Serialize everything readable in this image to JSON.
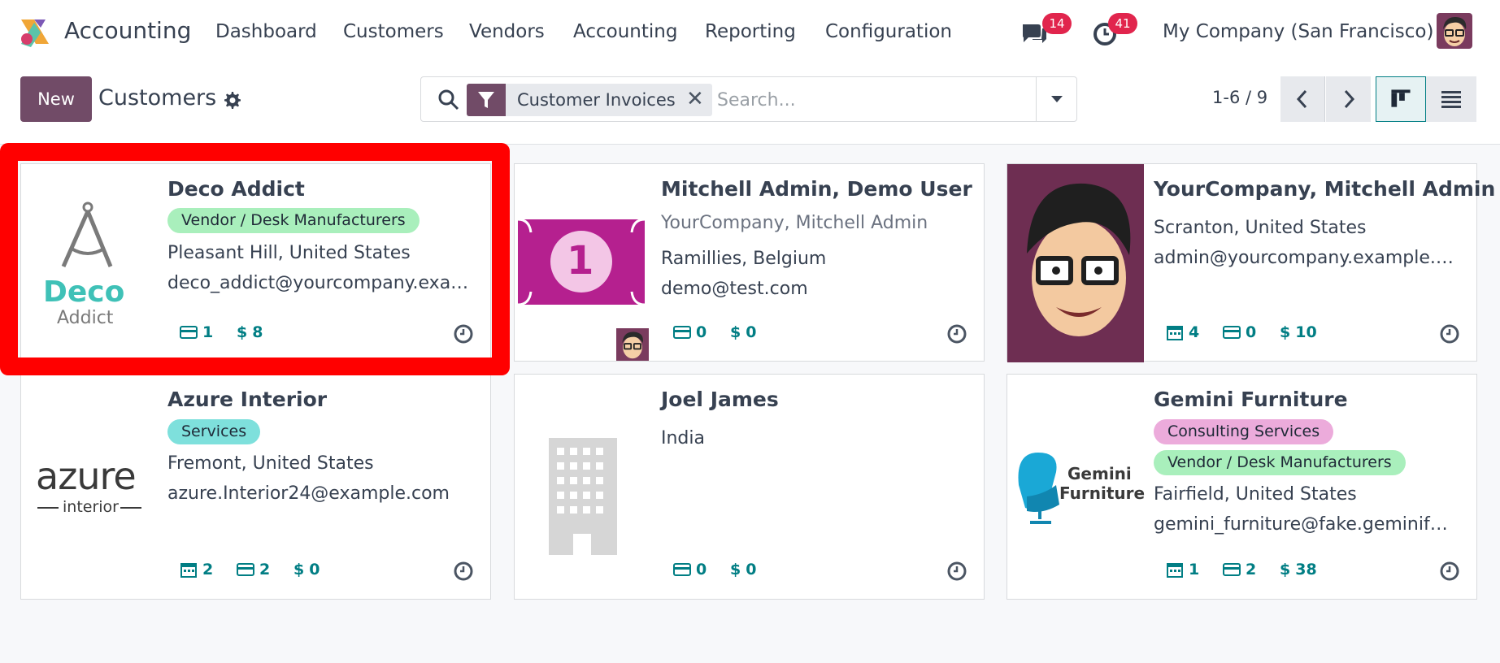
{
  "app": {
    "name": "Accounting",
    "nav": [
      "Dashboard",
      "Customers",
      "Vendors",
      "Accounting",
      "Reporting",
      "Configuration"
    ],
    "messages_badge": "14",
    "activities_badge": "41",
    "company": "My Company (San Francisco)"
  },
  "control": {
    "new_label": "New",
    "title": "Customers",
    "facet_label": "Customer Invoices",
    "search_placeholder": "Search...",
    "pager": "1-6 / 9"
  },
  "cards": [
    {
      "name": "Deco Addict",
      "tags": [
        {
          "label": "Vendor / Desk Manufacturers",
          "color": "#a9efbc"
        }
      ],
      "location": "Pleasant Hill, United States",
      "email": "deco_addict@yourcompany.exa…",
      "stats": {
        "invoices": "1",
        "amount": "8"
      },
      "logo_text": [
        "Deco",
        "Addict"
      ]
    },
    {
      "name": "Mitchell Admin, Demo User",
      "subtitle": "YourCompany, Mitchell Admin",
      "location": "Ramillies, Belgium",
      "email": "demo@test.com",
      "stats": {
        "invoices": "0",
        "amount": "0"
      },
      "logo_text": [
        "1"
      ]
    },
    {
      "name": "YourCompany, Mitchell Admin",
      "location": "Scranton, United States",
      "email": "admin@yourcompany.example.…",
      "stats": {
        "meetings": "4",
        "invoices": "0",
        "amount": "10"
      }
    },
    {
      "name": "Azure Interior",
      "tags": [
        {
          "label": "Services",
          "color": "#7ee0dc"
        }
      ],
      "location": "Fremont, United States",
      "email": "azure.Interior24@example.com",
      "stats": {
        "meetings": "2",
        "invoices": "2",
        "amount": "0"
      },
      "logo_text": [
        "azure",
        "interior"
      ]
    },
    {
      "name": "Joel James",
      "location": "India",
      "stats": {
        "invoices": "0",
        "amount": "0"
      }
    },
    {
      "name": "Gemini Furniture",
      "tags": [
        {
          "label": "Consulting Services",
          "color": "#ecabdb"
        },
        {
          "label": "Vendor / Desk Manufacturers",
          "color": "#a9efbc"
        }
      ],
      "location": "Fairfield, United States",
      "email": "gemini_furniture@fake.geminif…",
      "stats": {
        "meetings": "1",
        "invoices": "2",
        "amount": "38"
      },
      "logo_text": [
        "Gemini",
        "Furniture"
      ]
    }
  ],
  "colors": {
    "brand": "#714b67",
    "accent": "#017e84",
    "badge": "#e1254d",
    "highlight": "#ff0000"
  },
  "icons": {
    "stat_meetings": "calendar-icon",
    "stat_invoices": "credit-card-icon",
    "stat_amount": "dollar-icon",
    "activity": "clock-icon"
  }
}
